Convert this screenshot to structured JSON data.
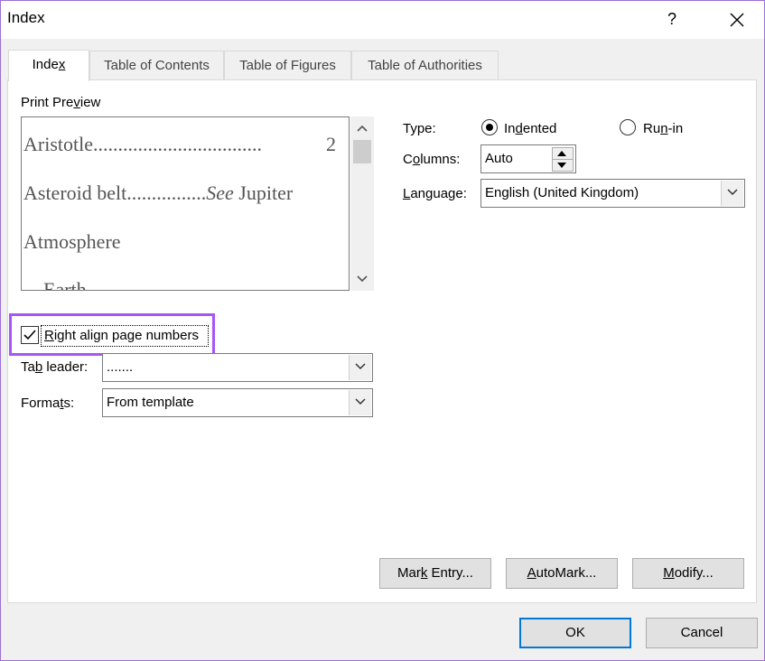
{
  "window": {
    "title": "Index",
    "help_label": "?",
    "close_icon": "close-icon"
  },
  "tabs": [
    {
      "label": "Index",
      "active": true
    },
    {
      "label": "Table of Contents",
      "active": false
    },
    {
      "label": "Table of Figures",
      "active": false
    },
    {
      "label": "Table of Authorities",
      "active": false
    }
  ],
  "preview": {
    "label": "Print Preview",
    "entries": [
      {
        "text": "Aristotle",
        "leader": "..................................",
        "page": "2"
      },
      {
        "text": "Asteroid belt",
        "leader": "................",
        "see": "See",
        "ref": "Jupiter"
      },
      {
        "text": "Atmosphere"
      },
      {
        "text": "Earth"
      }
    ]
  },
  "options": {
    "right_align_label": "Right align page numbers",
    "right_align_checked": true,
    "tab_leader_label": "Tab leader:",
    "tab_leader_value": ".......",
    "formats_label": "Formats:",
    "formats_value": "From template"
  },
  "type": {
    "label": "Type:",
    "indented_label": "Indented",
    "runin_label": "Run-in",
    "selected": "Indented"
  },
  "columns": {
    "label": "Columns:",
    "value": "Auto"
  },
  "language": {
    "label": "Language:",
    "value": "English (United Kingdom)"
  },
  "buttons": {
    "mark_entry": "Mark Entry...",
    "automark": "AutoMark...",
    "modify": "Modify...",
    "ok": "OK",
    "cancel": "Cancel"
  },
  "colors": {
    "highlight": "#a855f7",
    "ok_border": "#0078d7"
  }
}
